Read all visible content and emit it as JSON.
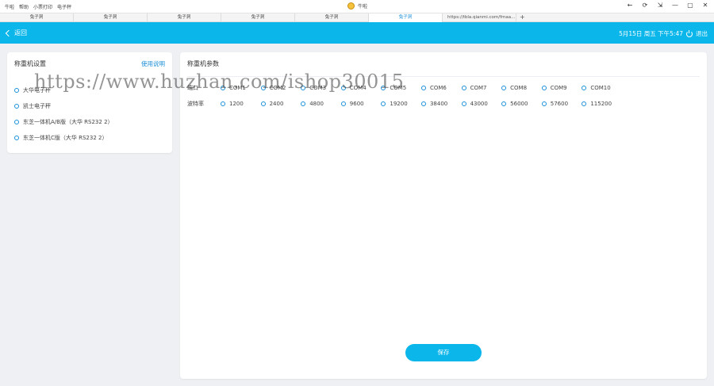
{
  "titlebar": {
    "menu": [
      "牛啦",
      "帮助",
      "小票打印",
      "电子秤"
    ],
    "app_title": "牛啦",
    "controls": [
      "←",
      "⟳",
      "⇲",
      "—",
      "▢",
      "✕"
    ]
  },
  "tabs": [
    {
      "label": "兔子洞",
      "active": false
    },
    {
      "label": "兔子洞",
      "active": false
    },
    {
      "label": "兔子洞",
      "active": false
    },
    {
      "label": "兔子洞",
      "active": false
    },
    {
      "label": "兔子洞",
      "active": false
    },
    {
      "label": "兔子洞",
      "active": true
    },
    {
      "label": "https://tbla.qianmi.com/fmaa...",
      "active": false
    }
  ],
  "tab_add": "+",
  "appbar": {
    "back_label": "返回",
    "datetime": "5月15日 周五 下午5:47",
    "logout_label": "退出"
  },
  "left_panel": {
    "title": "称重机设置",
    "help_link": "使用说明",
    "options": [
      "大华电子秤",
      "凯士电子秤",
      "东芝一体机A/B版（大华 RS232 2）",
      "东芝一体机C版（大华 RS232 2）"
    ]
  },
  "right_panel": {
    "title": "称重机参数",
    "port_label": "端口",
    "ports": [
      "COM1",
      "COM2",
      "COM3",
      "COM4",
      "COM5",
      "COM6",
      "COM7",
      "COM8",
      "COM9",
      "COM10"
    ],
    "baud_label": "波特率",
    "bauds": [
      "1200",
      "2400",
      "4800",
      "9600",
      "19200",
      "38400",
      "43000",
      "56000",
      "57600",
      "115200"
    ],
    "save_label": "保存"
  },
  "watermark": "https://www.huzhan.com/ishop30015",
  "colors": {
    "accent": "#0ab6ea",
    "link": "#1a8fd8"
  }
}
